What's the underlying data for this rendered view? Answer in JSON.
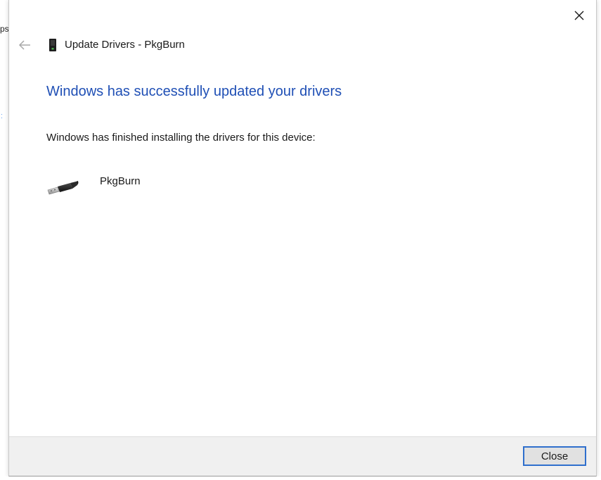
{
  "backdrop": {
    "glyph": "ps",
    "link_glyph": "ː"
  },
  "window": {
    "title": "Update Drivers - PkgBurn",
    "heading": "Windows has successfully updated your drivers",
    "message": "Windows has finished installing the drivers for this device:",
    "device_name": "PkgBurn",
    "close_button_label": "Close"
  },
  "icons": {
    "back": "back-arrow-icon",
    "close": "close-icon",
    "title": "usb-device-icon",
    "device": "usb-cable-icon"
  },
  "colors": {
    "heading": "#1f4fb5",
    "button_border": "#2f6fcd",
    "footer": "#f0f0f0"
  }
}
